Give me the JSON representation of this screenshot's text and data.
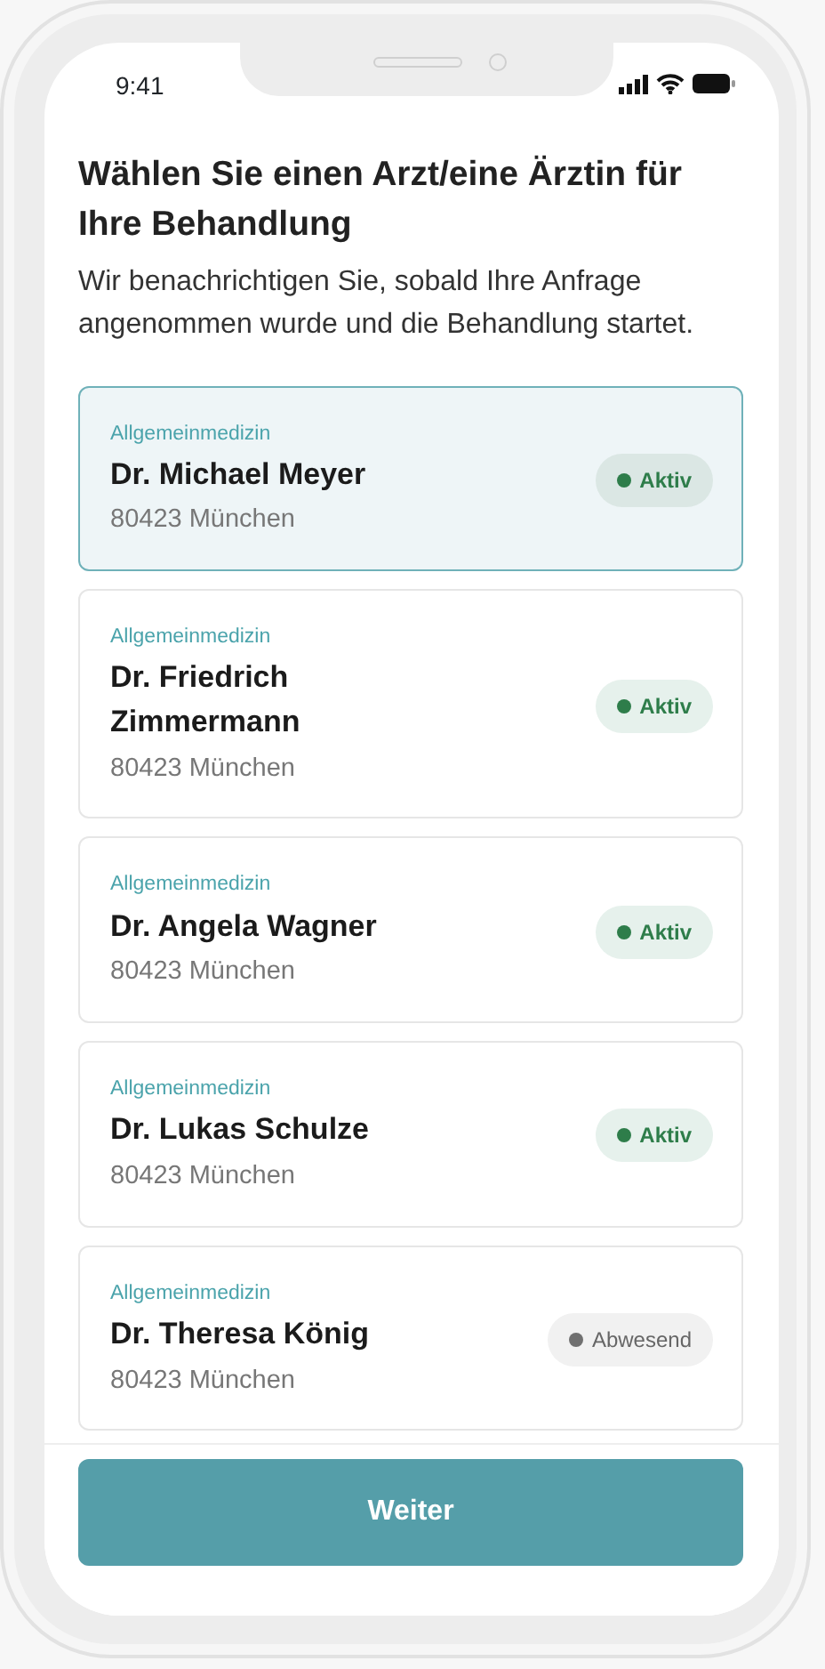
{
  "status_bar": {
    "time": "9:41"
  },
  "title": "Wählen Sie einen Arzt/eine Ärztin für Ihre Behandlung",
  "subtitle": "Wir benachrichtigen Sie, sobald Ihre Anfrage angenommen wurde und die Behandlung startet.",
  "doctors": [
    {
      "specialty": "Allgemeinmedizin",
      "name": "Dr. Michael Meyer",
      "address": "80423 München",
      "kind": "active",
      "status_label": "Aktiv",
      "selected": true
    },
    {
      "specialty": "Allgemeinmedizin",
      "name": "Dr. Friedrich Zimmermann",
      "address": "80423 München",
      "kind": "active",
      "status_label": "Aktiv",
      "selected": false
    },
    {
      "specialty": "Allgemeinmedizin",
      "name": "Dr. Angela Wagner",
      "address": "80423 München",
      "kind": "active",
      "status_label": "Aktiv",
      "selected": false
    },
    {
      "specialty": "Allgemeinmedizin",
      "name": "Dr. Lukas Schulze",
      "address": "80423 München",
      "kind": "active",
      "status_label": "Aktiv",
      "selected": false
    },
    {
      "specialty": "Allgemeinmedizin",
      "name": "Dr. Theresa König",
      "address": "80423 München",
      "kind": "away",
      "status_label": "Abwesend",
      "selected": false
    }
  ],
  "button": "Weiter"
}
